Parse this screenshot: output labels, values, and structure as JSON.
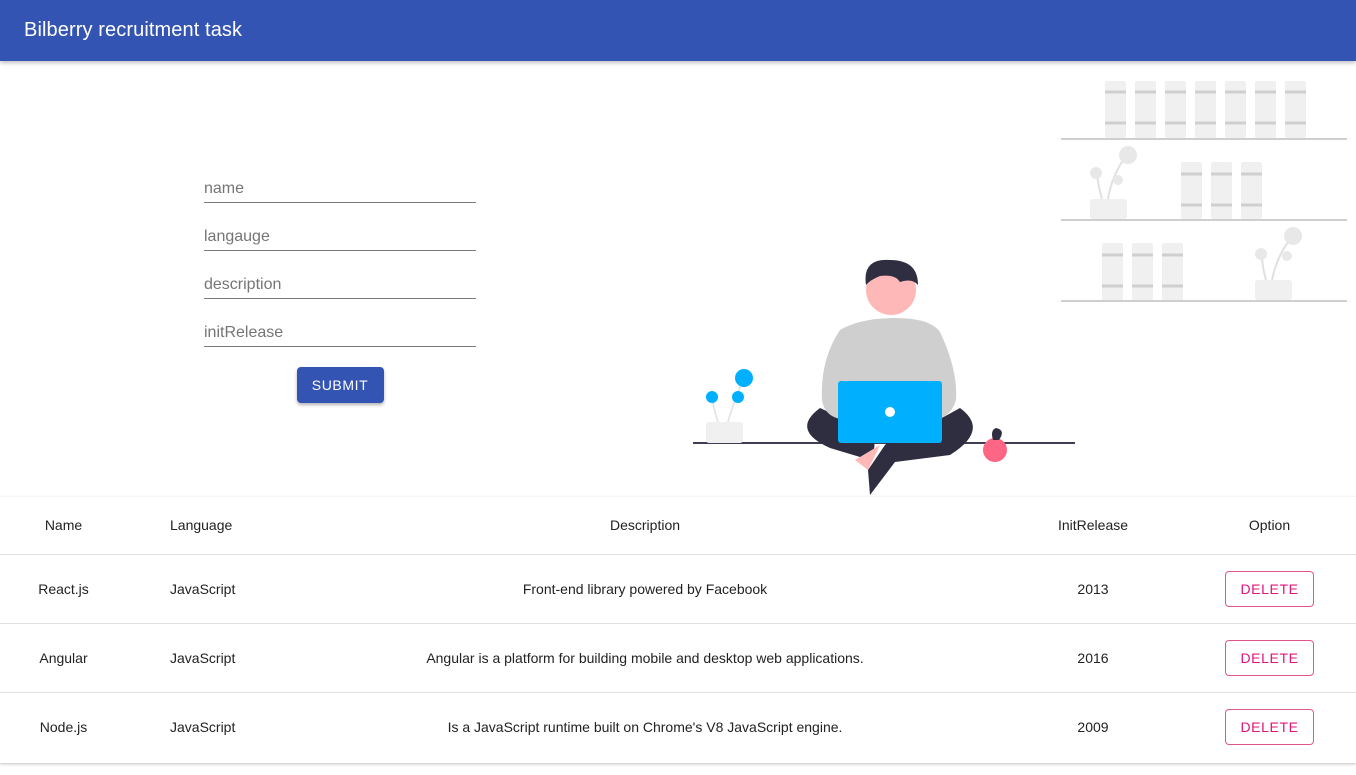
{
  "app": {
    "title": "Bilberry recruitment task"
  },
  "form": {
    "fields": [
      {
        "placeholder": "name"
      },
      {
        "placeholder": "langauge"
      },
      {
        "placeholder": "description"
      },
      {
        "placeholder": "initRelease"
      }
    ],
    "submit_label": "SUBMIT"
  },
  "table": {
    "headers": [
      "Name",
      "Language",
      "Description",
      "InitRelease",
      "Option"
    ],
    "rows": [
      {
        "name": "React.js",
        "language": "JavaScript",
        "description": "Front-end library powered by Facebook",
        "init_release": "2013",
        "action": "DELETE"
      },
      {
        "name": "Angular",
        "language": "JavaScript",
        "description": "Angular is a platform for building mobile and desktop web applications.",
        "init_release": "2016",
        "action": "DELETE"
      },
      {
        "name": "Node.js",
        "language": "JavaScript",
        "description": "Is a JavaScript runtime built on Chrome's V8 JavaScript engine.",
        "init_release": "2009",
        "action": "DELETE"
      }
    ]
  },
  "colors": {
    "primary": "#3454b4",
    "accent": "#e0157a",
    "illustration_blue": "#00b0ff"
  },
  "icons": [
    "person-with-laptop-illustration",
    "bookshelf-illustration"
  ]
}
